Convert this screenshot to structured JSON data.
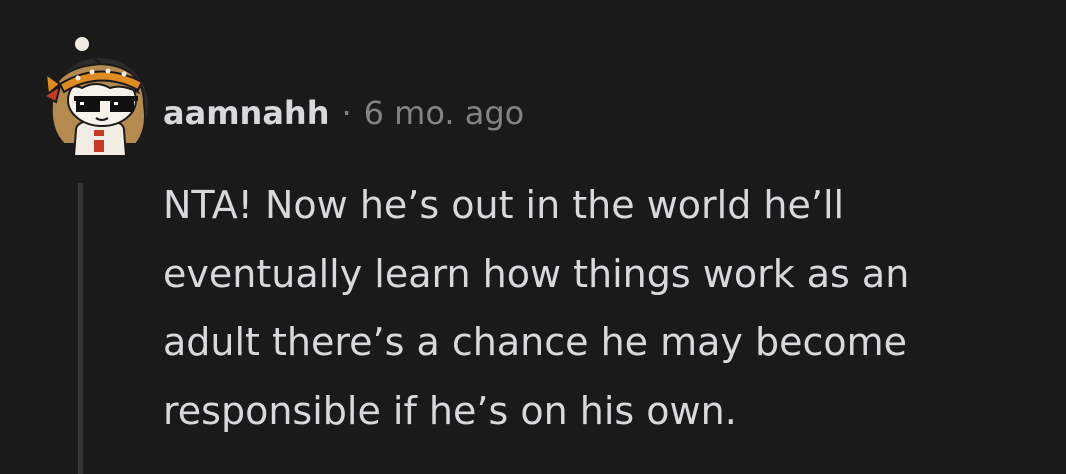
{
  "comment": {
    "username": "aamnahh",
    "separator": "·",
    "timestamp": "6 mo. ago",
    "body_lines": [
      "NTA! Now he’s out in the world he’ll",
      "eventually learn how things work as an",
      "adult there’s a chance he may become",
      "responsible if he’s on his own."
    ]
  },
  "colors": {
    "background": "#1a1a1b",
    "text": "#d7dadc",
    "meta_muted": "#818384",
    "thread_line": "#343536"
  },
  "icons": {
    "avatar": "snoo-avatar-with-pixel-sunglasses"
  }
}
